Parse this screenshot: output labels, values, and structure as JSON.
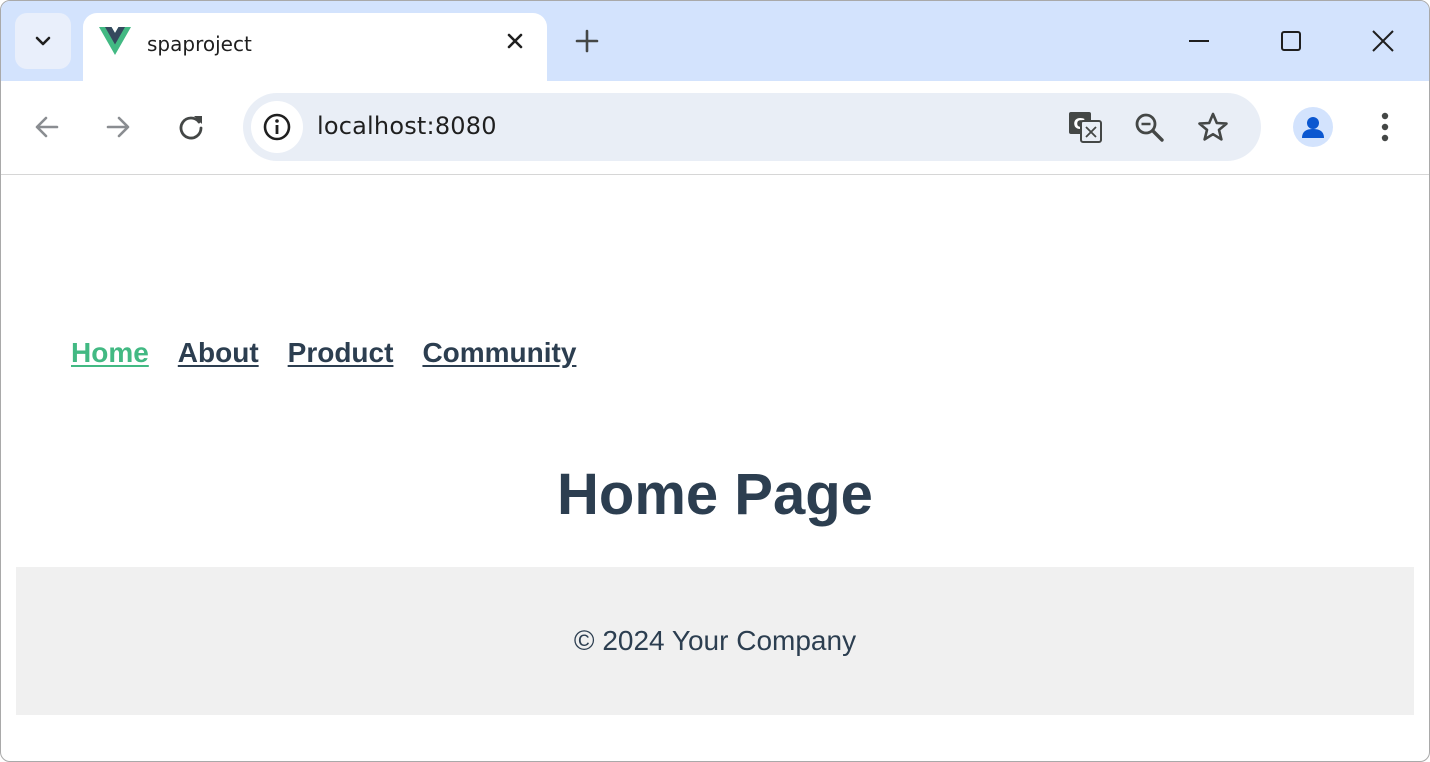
{
  "browser": {
    "tab": {
      "title": "spaproject",
      "favicon": "vue-logo-icon"
    },
    "address_bar": {
      "url": "localhost:8080"
    },
    "colors": {
      "tabstrip": "#d3e3fd",
      "omnibox": "#e9eef6",
      "profile_accent": "#0b57d0"
    }
  },
  "page": {
    "nav": {
      "links": [
        {
          "label": "Home",
          "active": true
        },
        {
          "label": "About",
          "active": false
        },
        {
          "label": "Product",
          "active": false
        },
        {
          "label": "Community",
          "active": false
        }
      ]
    },
    "heading": "Home Page",
    "footer": {
      "text": "© 2024 Your Company"
    },
    "colors": {
      "accent": "#42b983",
      "text": "#2c3e50",
      "footer_bg": "#f0f0f0"
    }
  }
}
